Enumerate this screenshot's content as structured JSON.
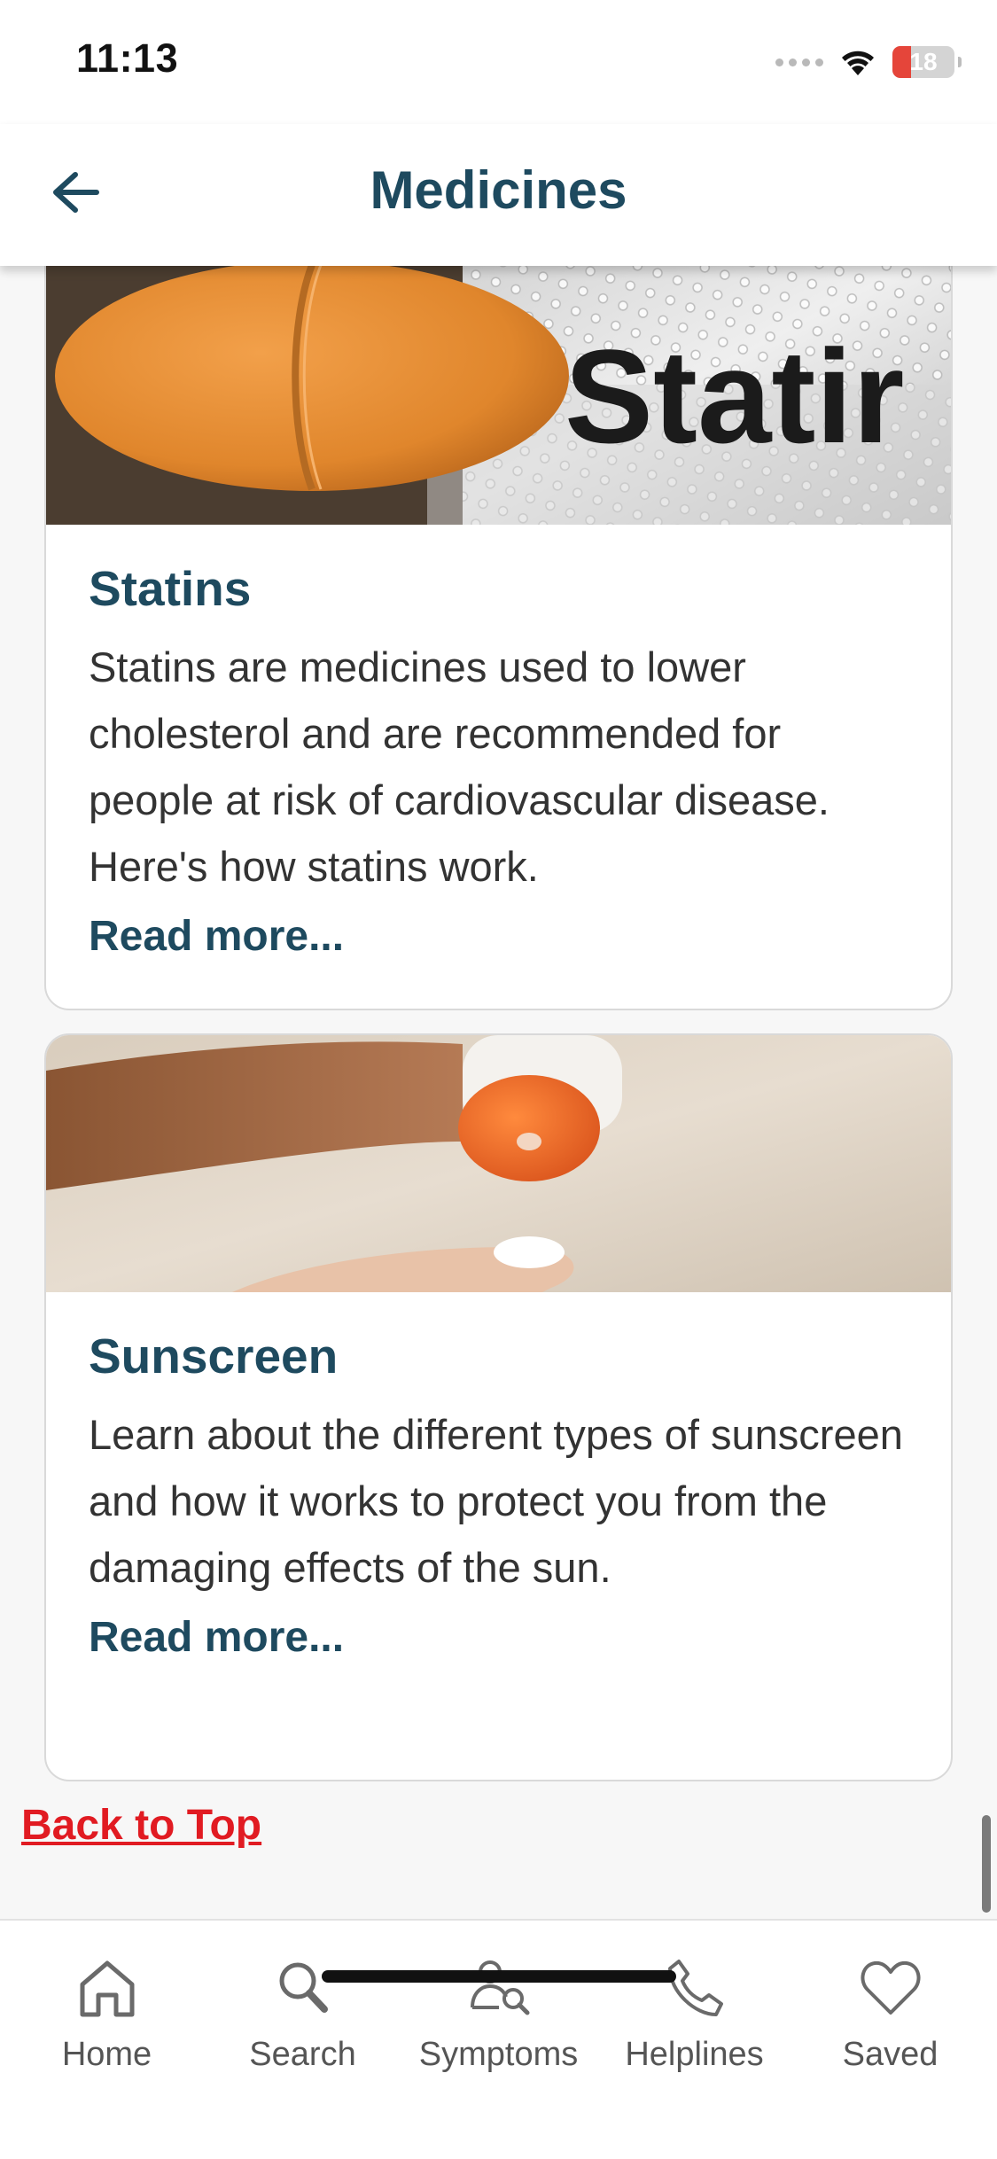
{
  "status_bar": {
    "time": "11:13",
    "battery_level": "18"
  },
  "header": {
    "title": "Medicines"
  },
  "cards": [
    {
      "title": "Statins",
      "description": "Statins are medicines used to lower cholesterol and are recommended for people at risk of cardiovascular disease. Here's how statins work.",
      "read_more": "Read more...",
      "image_text": "Statir"
    },
    {
      "title": "Sunscreen",
      "description": "Learn about the different types of sunscreen and how it works to protect you from the damaging effects of the sun.",
      "read_more": "Read more..."
    }
  ],
  "back_to_top": "Back to Top",
  "nav": {
    "items": [
      {
        "label": "Home",
        "icon": "home-icon"
      },
      {
        "label": "Search",
        "icon": "search-icon"
      },
      {
        "label": "Symptoms",
        "icon": "symptoms-icon"
      },
      {
        "label": "Helplines",
        "icon": "phone-icon"
      },
      {
        "label": "Saved",
        "icon": "heart-icon"
      }
    ]
  },
  "colors": {
    "brand": "#1e4a5f",
    "link_red": "#e11b22",
    "battery_low": "#e5453a"
  }
}
